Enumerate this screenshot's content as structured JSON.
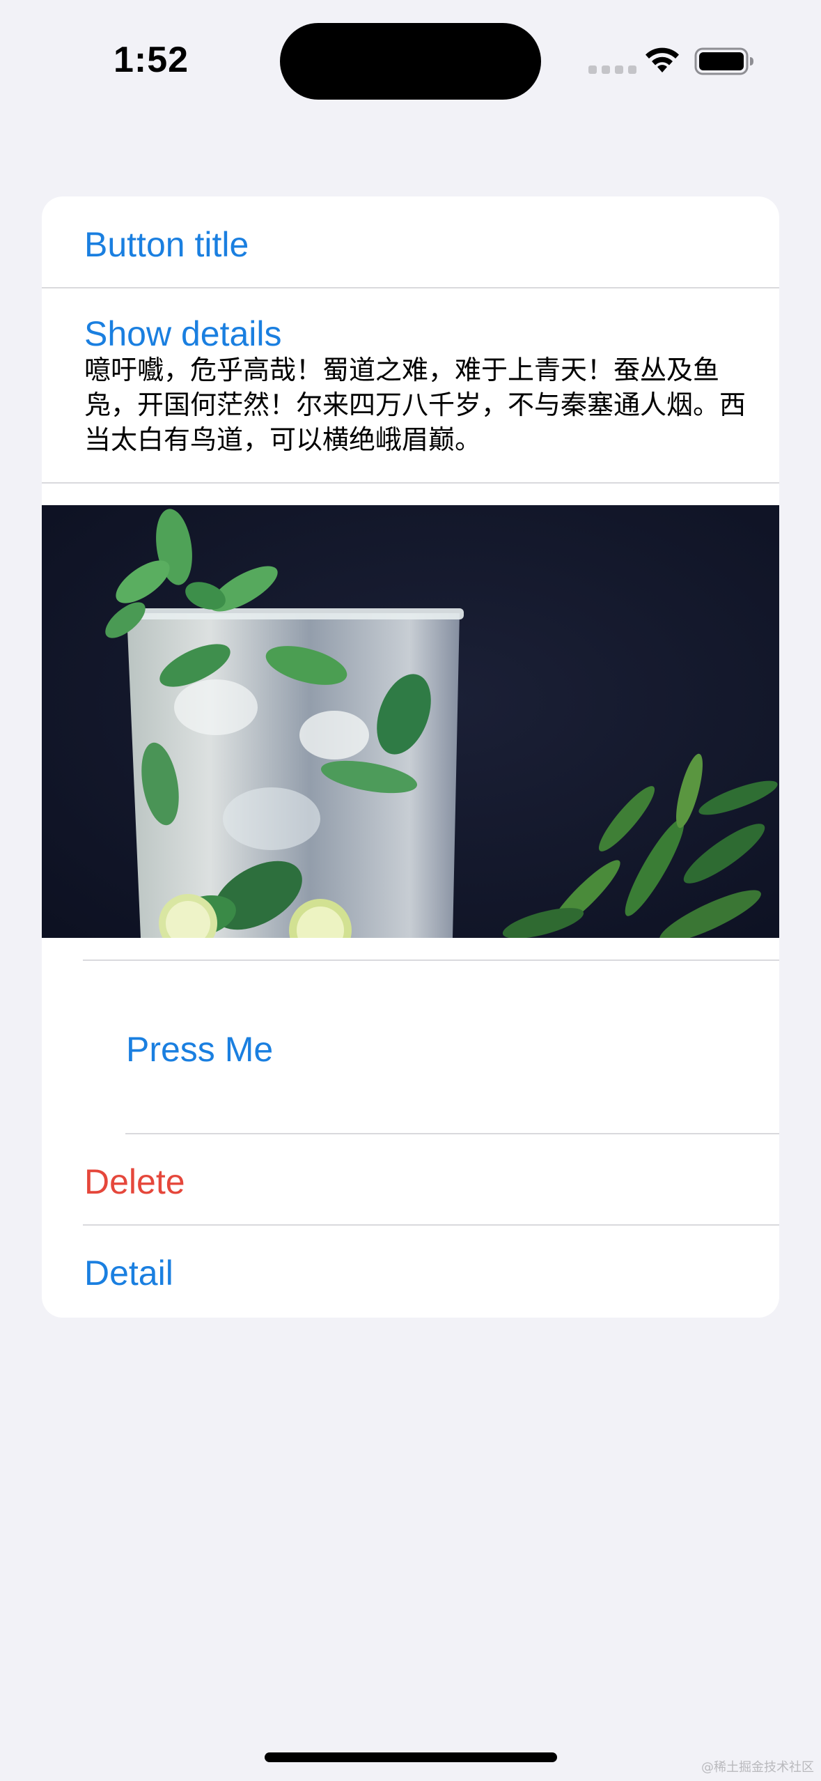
{
  "status_bar": {
    "time": "1:52"
  },
  "list": {
    "rows": [
      {
        "label": "Button title"
      },
      {
        "label": "Show details"
      },
      {
        "label": "Press Me"
      },
      {
        "label": "Delete"
      },
      {
        "label": "Detail"
      }
    ],
    "details_text": "噫吁嚱，危乎高哉！蜀道之难，难于上青天！蚕丛及鱼凫，开国何茫然！尔来四万八千岁，不与秦塞通人烟。西当太白有鸟道，可以横绝峨眉巅。",
    "image_icon": "mojito-photo"
  },
  "watermark": "@稀土掘金技术社区",
  "colors": {
    "background": "#f2f2f7",
    "card": "#ffffff",
    "accent": "#1a7fe0",
    "destructive": "#e5473b",
    "separator": "#d9d9dd"
  }
}
